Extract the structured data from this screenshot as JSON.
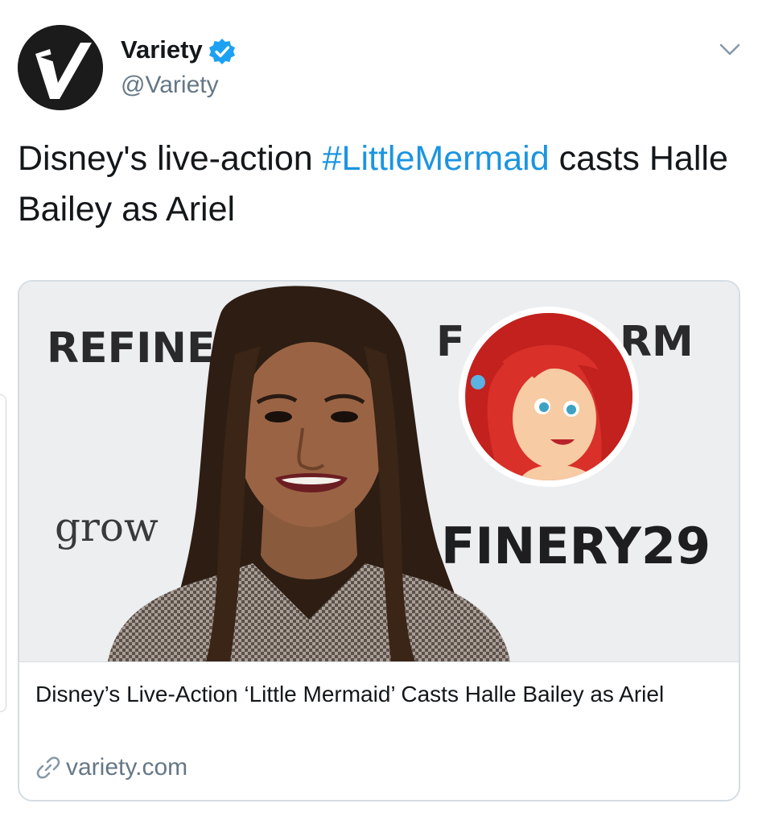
{
  "tweet": {
    "author": {
      "name": "Variety",
      "handle": "@Variety",
      "verified": true,
      "avatar_icon": "variety-v-logo"
    },
    "text_before": "Disney's live-action ",
    "hashtag": "#LittleMermaid",
    "text_after": " casts Halle Bailey as Ariel",
    "card": {
      "title": "Disney’s Live-Action ‘Little Mermaid’ Casts Halle Bailey as Ariel",
      "domain": "variety.com",
      "image": {
        "backdrop_texts": [
          "REFINE",
          "F",
          "RM",
          "grow",
          "FINERY29"
        ]
      }
    }
  },
  "colors": {
    "text": "#14171a",
    "secondary": "#657786",
    "link": "#1b95e0",
    "verified": "#1da1f2",
    "border": "#d5dde3"
  }
}
